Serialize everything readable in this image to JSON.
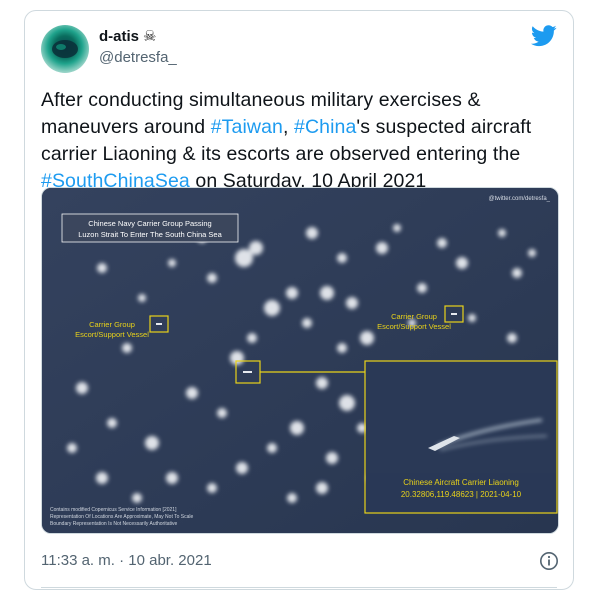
{
  "user": {
    "display_name": "d-atis",
    "badge_icon": "skull-crossbones-icon",
    "badge_glyph": "☠",
    "handle": "@detresfa_"
  },
  "tweet": {
    "t1": "After conducting simultaneous military exercises & maneuvers around ",
    "h1": "#Taiwan",
    "t2": ", ",
    "h2": "#China",
    "t3": "'s suspected aircraft carrier Liaoning & its escorts are observed entering the ",
    "h3": "#SouthChinaSea",
    "t4": " on Saturday, 10 April 2021"
  },
  "image": {
    "watermark": "@twitter.com/detresfa_",
    "title_line1": "Chinese Navy Carrier Group Passing",
    "title_line2": "Luzon Strait To Enter The South China Sea",
    "escort_left_line1": "Carrier Group",
    "escort_left_line2": "Escort/Support Vessel",
    "escort_right_line1": "Carrier Group",
    "escort_right_line2": "Escort/Support Vessel",
    "carrier_line1": "Chinese Aircraft Carrier Liaoning",
    "carrier_line2": "20.32806,119.48623 | 2021-04-10",
    "credit_line1": "Contains modified Copernicus Service Information [2021]",
    "credit_line2": "Representation Of Locations Are Approximate, May Not To Scale",
    "credit_line3": "Boundary Representation Is Not Necessarily Authoritative"
  },
  "timestamp": "11:33 a. m. · 10 abr. 2021",
  "colors": {
    "accent": "#1d9bf0",
    "annotation": "#e8d21a",
    "sea": "#2f3d58"
  }
}
